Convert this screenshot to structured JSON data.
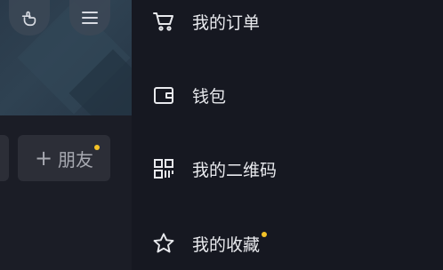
{
  "left_panel": {
    "header_buttons": [
      {
        "icon": "hand-pointer-icon"
      },
      {
        "icon": "menu-icon"
      }
    ],
    "friend_button": {
      "plus": "+",
      "label": "朋友",
      "has_dot": true
    }
  },
  "drawer": {
    "items": [
      {
        "icon": "cart-icon",
        "label": "我的订单"
      },
      {
        "icon": "wallet-icon",
        "label": "钱包"
      },
      {
        "icon": "qr-code-icon",
        "label": "我的二维码"
      },
      {
        "icon": "star-icon",
        "label": "我的收藏",
        "has_dot": true
      }
    ]
  },
  "colors": {
    "background": "#161821",
    "text": "#e9eaee",
    "badge_dot": "#f4c227",
    "chip": "#2c2e37"
  }
}
